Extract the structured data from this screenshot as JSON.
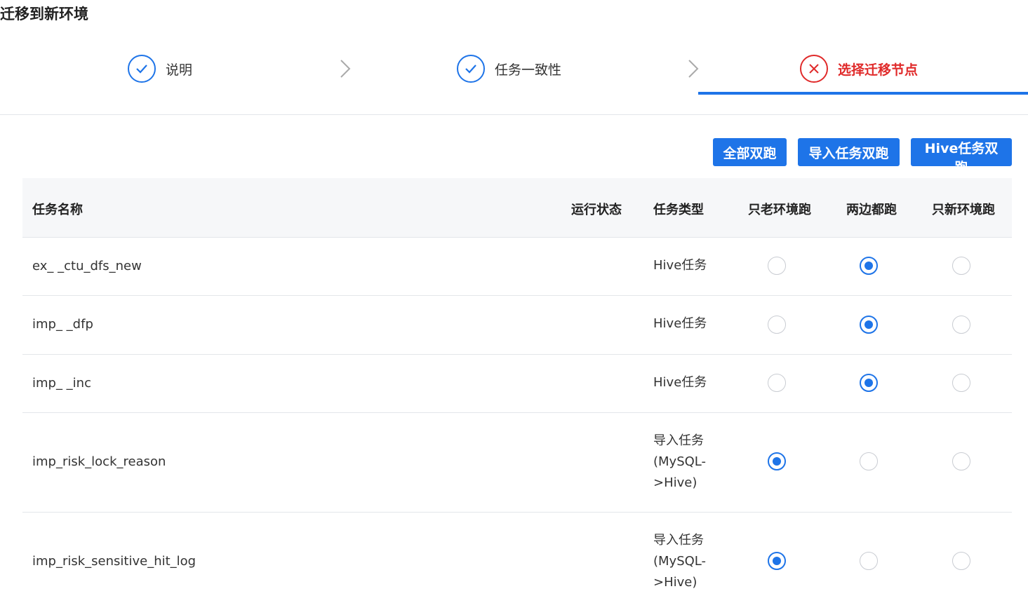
{
  "title": "迁移到新环境",
  "steps": [
    {
      "label": "说明",
      "status": "done",
      "icon": "check-icon"
    },
    {
      "label": "任务一致性",
      "status": "done",
      "icon": "check-icon"
    },
    {
      "label": "选择迁移节点",
      "status": "error",
      "icon": "close-icon"
    }
  ],
  "buttons": {
    "all_dual": "全部双跑",
    "import_dual": "导入任务双跑",
    "hive_dual": "Hive任务双跑"
  },
  "table": {
    "headers": {
      "name": "任务名称",
      "status": "运行状态",
      "type": "任务类型",
      "old_only": "只老环境跑",
      "both": "两边都跑",
      "new_only": "只新环境跑"
    },
    "rows": [
      {
        "name": "ex_ _ctu_dfs_new",
        "status": "",
        "type": "Hive任务",
        "selected": "both"
      },
      {
        "name": "imp_ _dfp",
        "status": "",
        "type": "Hive任务",
        "selected": "both"
      },
      {
        "name": "imp_ _inc",
        "status": "",
        "type": "Hive任务",
        "selected": "both"
      },
      {
        "name": "imp_risk_lock_reason",
        "status": "",
        "type": "导入任务(MySQL->Hive)",
        "type_lines": [
          "导入任务",
          "(MySQL-",
          ">Hive)"
        ],
        "selected": "old_only"
      },
      {
        "name": "imp_risk_sensitive_hit_log",
        "status": "",
        "type": "导入任务(MySQL->Hive)",
        "type_lines": [
          "导入任务",
          "(MySQL-",
          ">Hive)"
        ],
        "selected": "old_only"
      }
    ]
  },
  "colors": {
    "accent": "#1e74e8",
    "error": "#e02a2a"
  }
}
